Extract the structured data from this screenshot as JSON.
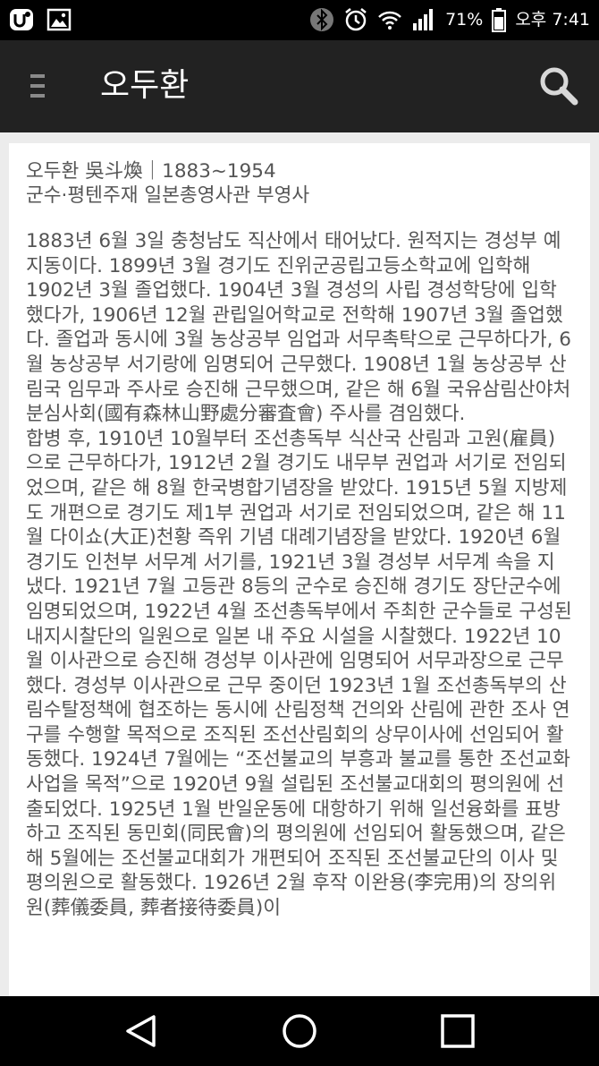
{
  "status_bar": {
    "icons_left": [
      "app-notification-icon",
      "gallery-icon"
    ],
    "icons_right": [
      "bluetooth-icon",
      "alarm-icon",
      "wifi-icon",
      "signal-icon",
      "battery-icon"
    ],
    "battery": "71%",
    "time": "오후 7:41"
  },
  "app_bar": {
    "title": "오두환",
    "menu_icon": "menu-icon",
    "search_icon": "search-icon"
  },
  "article": {
    "heading": "오두환 吳斗煥｜1883~1954",
    "subheading": "군수·평텐주재 일본총영사관 부영사",
    "paragraphs": [
      "1883년 6월 3일 충청남도 직산에서 태어났다. 원적지는 경성부 예지동이다. 1899년 3월 경기도 진위군공립고등소학교에 입학해 1902년 3월 졸업했다. 1904년 3월 경성의 사립 경성학당에 입학했다가, 1906년 12월 관립일어학교로 전학해 1907년 3월 졸업했다. 졸업과 동시에 3월 농상공부 임업과 서무촉탁으로 근무하다가, 6월 농상공부 서기랑에 임명되어 근무했다. 1908년 1월 농상공부 산림국 임무과 주사로 승진해 근무했으며, 같은 해 6월 국유삼림산야처분심사회(國有森林山野處分審査會) 주사를 겸임했다.",
      "합병 후, 1910년 10월부터 조선총독부 식산국 산림과 고원(雇員)으로 근무하다가, 1912년 2월 경기도 내무부 권업과 서기로 전임되었으며, 같은 해 8월 한국병합기념장을 받았다. 1915년 5월 지방제도 개편으로 경기도 제1부 권업과 서기로 전임되었으며, 같은 해 11월 다이쇼(大正)천황 즉위 기념 대례기념장을 받았다. 1920년 6월 경기도 인천부 서무계 서기를, 1921년 3월 경성부 서무계 속을 지냈다. 1921년 7월 고등관 8등의 군수로 승진해 경기도 장단군수에 임명되었으며, 1922년 4월 조선총독부에서 주최한 군수들로 구성된 내지시찰단의 일원으로 일본 내 주요 시설을 시찰했다. 1922년 10월 이사관으로 승진해 경성부 이사관에 임명되어 서무과장으로 근무했다. 경성부 이사관으로 근무 중이던 1923년 1월 조선총독부의 산림수탈정책에 협조하는 동시에 산림정책 건의와 산림에 관한 조사 연구를 수행할 목적으로 조직된 조선산림회의 상무이사에 선임되어 활동했다. 1924년 7월에는 “조선불교의 부흥과 불교를 통한 조선교화사업을 목적”으로 1920년 9월 설립된 조선불교대회의 평의원에 선출되었다. 1925년 1월 반일운동에 대항하기 위해 일선융화를 표방하고 조직된 동민회(同民會)의 평의원에 선임되어 활동했으며, 같은 해 5월에는 조선불교대회가 개편되어 조직된 조선불교단의 이사 및 평의원으로 활동했다. 1926년 2월 후작 이완용(李完用)의 장의위원(葬儀委員, 葬者接待委員)이"
    ]
  },
  "nav_bar": {
    "buttons": [
      "back-icon",
      "home-icon",
      "recents-icon"
    ]
  }
}
